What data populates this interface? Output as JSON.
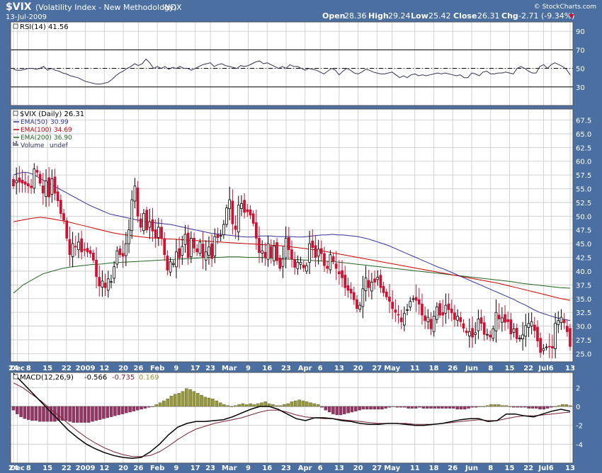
{
  "header": {
    "title": "$VIX",
    "subtitle": "(Volatility Index - New Methodology)",
    "exchange": "INDX",
    "date": "13-Jul-2009",
    "brand": "© StockCharts.com",
    "quote": {
      "open_label": "Open",
      "open": "28.36",
      "high_label": "High",
      "high": "29.24",
      "low_label": "Low",
      "low": "25.42",
      "close_label": "Close",
      "close": "26.31",
      "chg_label": "Chg",
      "chg": "-2.71 (-9.34%)"
    }
  },
  "colors": {
    "background": "#4a6fa0",
    "panel": "#ffffff",
    "grid": "#c8c8c8",
    "up": "#ffffff",
    "down": "#cc1133",
    "ema50": "#333399",
    "ema100": "#cc0000",
    "ema200": "#226622",
    "rsi": "#333355",
    "macd": "#000000",
    "signal": "#772233",
    "hist_neg": "#993366",
    "hist_pos": "#999933"
  },
  "x_axis": {
    "labels": [
      "24",
      "Dec",
      "8",
      "15",
      "22",
      "2009",
      "12",
      "20",
      "26",
      "Feb",
      "9",
      "17",
      "23",
      "Mar",
      "9",
      "16",
      "23",
      "Apr",
      "6",
      "13",
      "20",
      "27",
      "May",
      "11",
      "18",
      "26",
      "Jun",
      "8",
      "15",
      "22",
      "Jul",
      "6",
      "13"
    ],
    "label_index": [
      0,
      1,
      4,
      9,
      14,
      19,
      24,
      29,
      33,
      38,
      43,
      48,
      52,
      57,
      62,
      67,
      72,
      77,
      81,
      86,
      91,
      96,
      100,
      106,
      111,
      116,
      121,
      126,
      131,
      136,
      140,
      142,
      147
    ]
  },
  "chart_data": [
    {
      "type": "line",
      "panel": "rsi",
      "legend": "RSI(14) 41.56",
      "ylim": [
        10,
        100
      ],
      "ticks": [
        30,
        50,
        70,
        90
      ],
      "tick_labels": [
        "30",
        "50",
        "70",
        "90"
      ],
      "reference_lines": [
        30,
        50,
        70
      ],
      "values": [
        49,
        48,
        48,
        49,
        50,
        50,
        49,
        50,
        52,
        48,
        50,
        48,
        47,
        45,
        44,
        42,
        41,
        40,
        38,
        36,
        35,
        34,
        33,
        33,
        34,
        35,
        38,
        42,
        45,
        47,
        50,
        52,
        55,
        53,
        55,
        60,
        56,
        50,
        52,
        50,
        52,
        49,
        51,
        50,
        52,
        50,
        50,
        48,
        50,
        52,
        54,
        55,
        56,
        52,
        54,
        55,
        53,
        52,
        51,
        50,
        53,
        52,
        53,
        55,
        57,
        58,
        55,
        56,
        54,
        52,
        50,
        52,
        50,
        54,
        52,
        52,
        50,
        48,
        50,
        49,
        48,
        46,
        44,
        47,
        50,
        48,
        43,
        47,
        50,
        48,
        45,
        44,
        46,
        49,
        48,
        46,
        45,
        44,
        44,
        45,
        46,
        43,
        40,
        42,
        40,
        43,
        44,
        42,
        43,
        42,
        43,
        44,
        45,
        44,
        45,
        44,
        43,
        42,
        43,
        40,
        40,
        45,
        44,
        42,
        46,
        47,
        44,
        44,
        45,
        45,
        46,
        45,
        44,
        50,
        52,
        50,
        47,
        45,
        45,
        52,
        54,
        50,
        54,
        56,
        54,
        52,
        49,
        43
      ]
    },
    {
      "type": "candlestick",
      "panel": "price",
      "legend": "$VIX (Daily) 26.31",
      "series": [
        {
          "name": "EMA(50)",
          "value": "30.99"
        },
        {
          "name": "EMA(100)",
          "value": "34.69"
        },
        {
          "name": "EMA(200)",
          "value": "36.90"
        },
        {
          "name": "Volume",
          "value": "undef"
        }
      ],
      "ylim": [
        23.5,
        69.5
      ],
      "ticks": [
        25,
        27.5,
        30,
        32.5,
        35,
        37.5,
        40,
        42.5,
        45,
        47.5,
        50,
        52.5,
        55,
        57.5,
        60,
        62.5,
        65,
        67.5
      ],
      "tick_labels": [
        "25.0",
        "27.5",
        "30.0",
        "32.5",
        "35.0",
        "37.5",
        "40.0",
        "42.5",
        "45.0",
        "47.5",
        "50.0",
        "52.5",
        "55.0",
        "57.5",
        "60.0",
        "62.5",
        "65.0",
        "67.5"
      ],
      "close": [
        55.5,
        56.5,
        56.2,
        56.0,
        55.8,
        55.5,
        55.2,
        58.6,
        58.0,
        56.0,
        54.2,
        56.4,
        53.5,
        56.8,
        54.2,
        52.8,
        50.5,
        49.3,
        46.0,
        43.0,
        45.0,
        44.5,
        45.3,
        43.5,
        43.8,
        43.5,
        43.2,
        42.0,
        39.0,
        37.3,
        38.2,
        37.0,
        38.6,
        38.1,
        40.8,
        43.7,
        43.0,
        42.7,
        45.0,
        47.5,
        53.0,
        55.5,
        50.0,
        48.0,
        50.5,
        47.5,
        49.0,
        47.3,
        46.0,
        48.0,
        46.0,
        43.0,
        40.2,
        41.7,
        41.4,
        43.5,
        42.4,
        44.5,
        46.7,
        42.5,
        46.0,
        44.2,
        43.5,
        45.3,
        42.5,
        43.5,
        44.4,
        42.3,
        46.3,
        46.1,
        46.5,
        48.5,
        51.5,
        53.0,
        48.6,
        47.6,
        52.0,
        52.3,
        50.7,
        50.8,
        50.2,
        48.7,
        46.0,
        43.4,
        43.7,
        42.5,
        45.0,
        42.5,
        44.6,
        41.9,
        40.5,
        42.2,
        46.0,
        43.9,
        42.2,
        40.7,
        41.6,
        41.6,
        40.6,
        41.0,
        45.0,
        44.3,
        42.5,
        44.0,
        43.2,
        41.0,
        40.5,
        43.0,
        41.8,
        40.5,
        39.5,
        38.8,
        37.0,
        36.5,
        36.0,
        34.8,
        33.2,
        33.8,
        36.8,
        38.8,
        37.0,
        38.0,
        38.0,
        38.9,
        37.0,
        36.1,
        35.3,
        34.5,
        33.2,
        32.5,
        32.0,
        30.8,
        32.3,
        33.0,
        34.5,
        35.0,
        34.7,
        34.0,
        32.0,
        31.0,
        31.6,
        29.5,
        31.8,
        33.5,
        32.0,
        32.0,
        33.8,
        33.0,
        32.4,
        31.2,
        31.8,
        30.8,
        29.6,
        28.8,
        29.0,
        28.0,
        28.8,
        31.3,
        30.5,
        28.5,
        28.5,
        28.0,
        29.5,
        32.5,
        31.3,
        31.5,
        30.7,
        30.8,
        28.6,
        29.5,
        27.7,
        27.8,
        28.4,
        30.1,
        30.5,
        30.8,
        29.2,
        27.3,
        25.2,
        25.9,
        26.2,
        26.3,
        26.0,
        30.5,
        31.0,
        31.6,
        30.6,
        29.0,
        26.3
      ],
      "ema50": [
        57.5,
        57.8,
        58.0,
        57.9,
        57.6,
        57.0,
        56.5,
        56.0,
        55.5,
        55.0,
        54.5,
        54.0,
        53.5,
        53.0,
        52.5,
        52.0,
        51.6,
        51.2,
        50.8,
        50.4,
        50.2,
        50.0,
        49.8,
        49.6,
        49.4,
        49.2,
        49.0,
        48.9,
        48.8,
        48.7,
        48.6,
        48.5,
        48.3,
        48.1,
        47.9,
        47.7,
        47.5,
        47.3,
        47.1,
        46.9,
        46.8,
        46.7,
        46.6,
        46.5,
        46.4,
        46.3,
        46.2,
        46.2,
        46.3,
        46.4,
        46.4,
        46.4,
        46.3,
        46.3,
        46.3,
        46.3,
        46.2,
        46.2,
        46.3,
        46.4,
        46.5,
        46.6,
        46.6,
        46.7,
        46.6,
        46.6,
        46.5,
        46.4,
        46.3,
        46.1,
        45.9,
        45.6,
        45.3,
        45.0,
        44.7,
        44.3,
        43.9,
        43.5,
        43.1,
        42.7,
        42.3,
        41.9,
        41.5,
        41.1,
        40.7,
        40.4,
        40.0,
        39.6,
        39.2,
        38.8,
        38.4,
        38.0,
        37.6,
        37.2,
        36.8,
        36.4,
        36.0,
        35.6,
        35.2,
        34.8,
        34.3,
        33.9,
        33.4,
        32.9,
        32.5,
        32.2,
        31.9,
        31.6,
        31.4,
        31.2,
        31.0
      ],
      "ema100": [
        49.0,
        49.3,
        49.6,
        49.8,
        49.6,
        49.3,
        49.0,
        48.6,
        48.2,
        47.8,
        47.4,
        47.0,
        46.7,
        46.5,
        46.3,
        46.1,
        46.0,
        45.9,
        45.8,
        45.7,
        45.6,
        45.5,
        45.4,
        45.3,
        45.2,
        45.1,
        45.0,
        44.9,
        44.8,
        44.7,
        44.6,
        44.4,
        44.2,
        44.0,
        43.8,
        43.5,
        43.2,
        42.9,
        42.6,
        42.3,
        42.0,
        41.7,
        41.4,
        41.1,
        40.8,
        40.5,
        40.2,
        39.9,
        39.6,
        39.3,
        39.0,
        38.7,
        38.4,
        38.1,
        37.8,
        37.4,
        37.0,
        36.6,
        36.2,
        35.8,
        35.4,
        35.0,
        34.7
      ],
      "ema200": [
        36.0,
        37.5,
        38.5,
        39.5,
        40.0,
        40.5,
        40.8,
        41.0,
        41.2,
        41.3,
        41.5,
        41.6,
        41.7,
        41.8,
        41.9,
        42.0,
        42.1,
        42.2,
        42.3,
        42.4,
        42.5,
        42.5,
        42.6,
        42.6,
        42.5,
        42.5,
        42.4,
        42.3,
        42.2,
        42.1,
        42.0,
        41.9,
        41.8,
        41.7,
        41.5,
        41.3,
        41.1,
        40.9,
        40.7,
        40.5,
        40.3,
        40.1,
        39.9,
        39.7,
        39.5,
        39.3,
        39.1,
        38.9,
        38.7,
        38.5,
        38.3,
        38.1,
        37.8,
        37.6,
        37.4,
        37.2,
        37.0,
        36.9
      ]
    },
    {
      "type": "line+bar",
      "panel": "macd",
      "legend_label": "MACD(12,26,9)",
      "macd_value": "-0.566",
      "signal_value": "-0.735",
      "hist_value": "0.169",
      "ylim": [
        -6,
        3.6
      ],
      "ticks": [
        -4,
        -2,
        0,
        2
      ],
      "tick_labels": [
        "-4",
        "-2",
        "0",
        "2"
      ],
      "macd": [
        3.5,
        2.5,
        1.5,
        0.5,
        -0.5,
        -1.5,
        -2.5,
        -3.3,
        -4.0,
        -4.5,
        -4.9,
        -5.2,
        -5.4,
        -5.5,
        -5.4,
        -4.8,
        -4.0,
        -3.0,
        -2.2,
        -1.8,
        -1.6,
        -1.6,
        -1.5,
        -1.4,
        -1.1,
        -0.7,
        -0.3,
        0.0,
        0.0,
        -0.3,
        -0.8,
        -1.3,
        -1.5,
        -1.2,
        -1.2,
        -1.3,
        -1.5,
        -1.6,
        -1.8,
        -1.9,
        -1.9,
        -1.8,
        -1.8,
        -1.9,
        -2.0,
        -2.0,
        -1.9,
        -1.8,
        -1.6,
        -1.4,
        -1.3,
        -1.3,
        -1.6,
        -1.5,
        -0.8,
        -0.8,
        -1.0,
        -1.1,
        -0.8,
        -0.5,
        -0.3,
        -0.5
      ],
      "signal": [
        2.5,
        2.0,
        1.3,
        0.6,
        -0.2,
        -1.0,
        -1.8,
        -2.6,
        -3.3,
        -3.9,
        -4.4,
        -4.8,
        -5.1,
        -5.3,
        -5.3,
        -5.2,
        -4.8,
        -4.2,
        -3.5,
        -2.9,
        -2.4,
        -2.1,
        -1.8,
        -1.6,
        -1.4,
        -1.2,
        -0.9,
        -0.6,
        -0.4,
        -0.4,
        -0.6,
        -0.9,
        -1.1,
        -1.2,
        -1.3,
        -1.3,
        -1.4,
        -1.5,
        -1.6,
        -1.7,
        -1.8,
        -1.8,
        -1.8,
        -1.8,
        -1.9,
        -1.9,
        -1.9,
        -1.8,
        -1.7,
        -1.6,
        -1.5,
        -1.4,
        -1.5,
        -1.5,
        -1.3,
        -1.1,
        -1.0,
        -1.0,
        -0.9,
        -0.8,
        -0.7,
        -0.6
      ],
      "histogram": [
        -0.4,
        -0.8,
        -1.1,
        -1.3,
        -1.4,
        -1.5,
        -1.5,
        -1.6,
        -1.6,
        -1.6,
        -1.6,
        -1.6,
        -1.5,
        -1.5,
        -1.5,
        -1.6,
        -1.7,
        -1.7,
        -1.7,
        -1.7,
        -1.7,
        -1.6,
        -1.5,
        -1.4,
        -1.3,
        -1.2,
        -1.1,
        -1.0,
        -0.9,
        -0.8,
        -0.7,
        -0.6,
        -0.5,
        -0.4,
        -0.3,
        -0.2,
        -0.1,
        0.0,
        0.2,
        0.4,
        0.6,
        0.8,
        1.1,
        1.3,
        1.4,
        1.6,
        1.9,
        1.8,
        1.6,
        1.4,
        1.2,
        1.0,
        0.9,
        0.8,
        0.6,
        0.4,
        0.2,
        0.1,
        0.0,
        0.1,
        0.2,
        0.3,
        0.2,
        0.3,
        0.2,
        0.3,
        0.4,
        0.5,
        0.3,
        0.2,
        0.1,
        0.1,
        0.2,
        0.3,
        0.5,
        0.6,
        0.7,
        0.6,
        0.5,
        0.4,
        0.3,
        0.2,
        -0.1,
        -0.4,
        -0.6,
        -0.8,
        -0.9,
        -0.9,
        -0.8,
        -0.7,
        -0.6,
        -0.5,
        -0.4,
        -0.3,
        -0.3,
        -0.3,
        -0.3,
        -0.3,
        -0.3,
        -0.2,
        -0.1,
        0.0,
        -0.1,
        -0.1,
        -0.1,
        -0.2,
        -0.2,
        -0.2,
        -0.1,
        -0.2,
        -0.2,
        -0.2,
        -0.2,
        -0.2,
        -0.2,
        -0.2,
        -0.2,
        -0.2,
        -0.3,
        -0.3,
        -0.3,
        -0.2,
        -0.1,
        -0.1,
        0.0,
        0.0,
        0.1,
        0.2,
        0.2,
        0.2,
        0.1,
        0.1,
        0.0,
        -0.1,
        -0.1,
        -0.1,
        -0.1,
        -0.2,
        -0.2,
        -0.2,
        -0.3,
        -0.3,
        -0.2,
        -0.1,
        0.0,
        0.1,
        0.2,
        0.2,
        0.1
      ]
    }
  ]
}
